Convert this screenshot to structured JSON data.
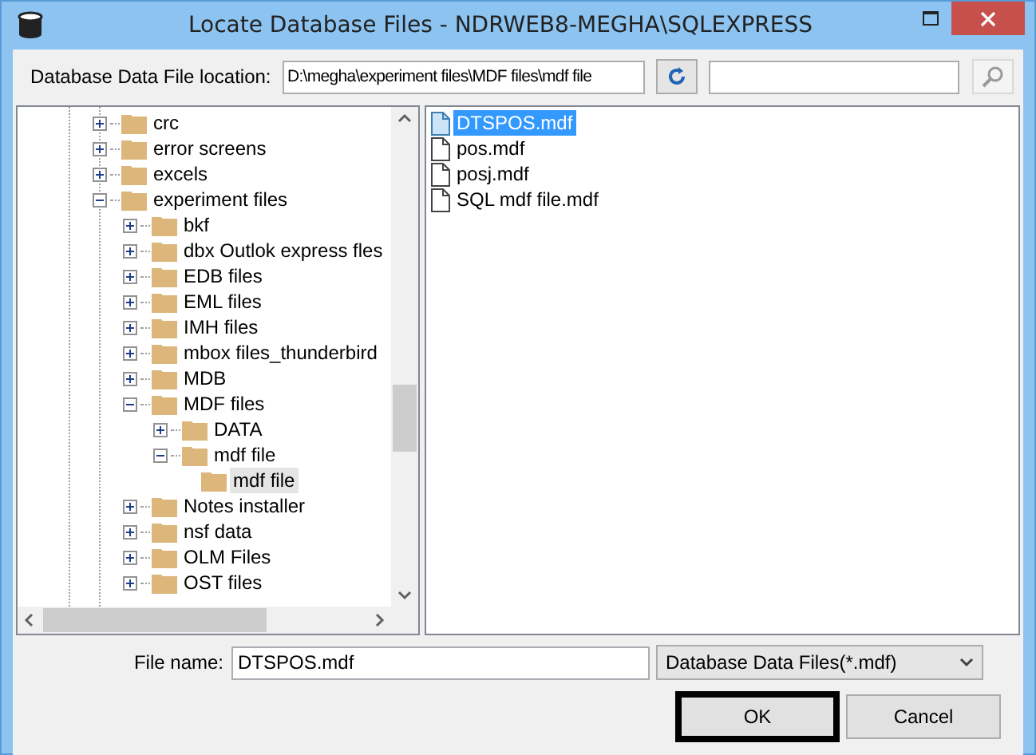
{
  "window": {
    "title": "Locate Database Files - NDRWEB8-MEGHA\\SQLEXPRESS"
  },
  "location": {
    "label": "Database Data File location:",
    "value": "D:\\megha\\experiment files\\MDF files\\mdf file"
  },
  "folder_tree": [
    {
      "label": "crc",
      "expanded": false,
      "selected": false
    },
    {
      "label": "error screens",
      "expanded": false,
      "selected": false
    },
    {
      "label": "excels",
      "expanded": false,
      "selected": false
    },
    {
      "label": "experiment files",
      "expanded": true,
      "selected": false,
      "children": [
        {
          "label": "bkf",
          "expanded": false,
          "selected": false
        },
        {
          "label": "dbx Outlok express fles",
          "expanded": false,
          "selected": false
        },
        {
          "label": "EDB files",
          "expanded": false,
          "selected": false
        },
        {
          "label": "EML files",
          "expanded": false,
          "selected": false
        },
        {
          "label": "IMH files",
          "expanded": false,
          "selected": false
        },
        {
          "label": "mbox files_thunderbird",
          "expanded": false,
          "selected": false
        },
        {
          "label": "MDB",
          "expanded": false,
          "selected": false
        },
        {
          "label": "MDF files",
          "expanded": true,
          "selected": false,
          "children": [
            {
              "label": "DATA",
              "expanded": false,
              "selected": false
            },
            {
              "label": "mdf file",
              "expanded": true,
              "selected": false,
              "children": [
                {
                  "label": "mdf file",
                  "selected": true
                }
              ]
            }
          ]
        },
        {
          "label": "Notes installer",
          "expanded": false,
          "selected": false
        },
        {
          "label": "nsf data",
          "expanded": false,
          "selected": false
        },
        {
          "label": "OLM Files",
          "expanded": false,
          "selected": false
        },
        {
          "label": "OST files",
          "expanded": false,
          "selected": false
        }
      ]
    }
  ],
  "files": [
    {
      "name": "DTSPOS.mdf",
      "selected": true
    },
    {
      "name": "pos.mdf",
      "selected": false
    },
    {
      "name": "posj.mdf",
      "selected": false
    },
    {
      "name": "SQL mdf file.mdf",
      "selected": false
    }
  ],
  "file_name": {
    "label": "File name:",
    "value": "DTSPOS.mdf"
  },
  "file_type": {
    "value": "Database Data Files(*.mdf)"
  },
  "buttons": [
    {
      "label": "OK",
      "default": true
    },
    {
      "label": "Cancel",
      "default": false
    }
  ]
}
